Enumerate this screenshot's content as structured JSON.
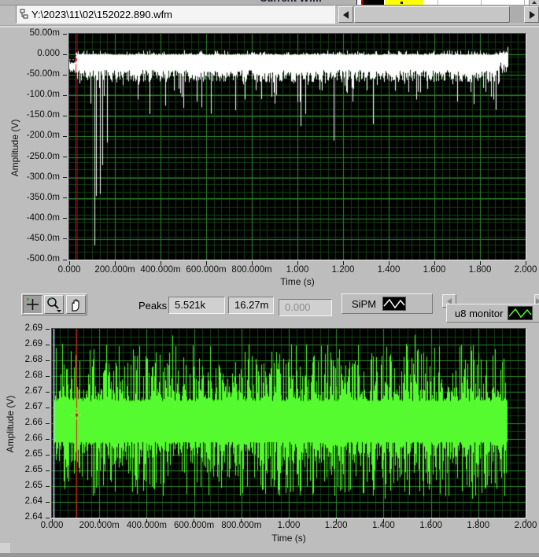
{
  "window": {
    "app": "LabVIEW waveform viewer"
  },
  "top_bar": {
    "clipped_label": "Current Wfm",
    "path_field": {
      "value": "Y:\\2023\\11\\02\\152022.890.wfm",
      "icon": "path-glyph"
    },
    "scrollbar": {
      "orientation": "horizontal"
    }
  },
  "toolbar": {
    "peaks_label": "Peaks",
    "peak_count": "5.521k",
    "peak_value": "16.27m",
    "peak_aux": "0.000",
    "legend_sipm": {
      "label": "SiPM",
      "plot_color": "#ffffff"
    },
    "legend_u8": {
      "label": "u8 monitor",
      "plot_color": "#55fb2e"
    },
    "palette": {
      "tools": [
        "cursor-crosshair",
        "zoom-magnifier",
        "pan-hand"
      ]
    }
  },
  "chart_data": [
    {
      "type": "line",
      "title": "SiPM",
      "xlabel": "Time (s)",
      "ylabel": "Amplitude (V)",
      "x_ticks": [
        "0.000",
        "200.000m",
        "400.000m",
        "600.000m",
        "800.000m",
        "1.000",
        "1.200",
        "1.400",
        "1.600",
        "1.800",
        "2.000"
      ],
      "y_ticks": [
        "50.00m",
        "0.000",
        "-50.00m",
        "-100.0m",
        "-150.0m",
        "-200.0m",
        "-250.0m",
        "-300.0m",
        "-350.0m",
        "-400.0m",
        "-450.0m",
        "-500.0m"
      ],
      "xlim": [
        0,
        2.0
      ],
      "ylim": [
        -0.5,
        0.05
      ],
      "grid": {
        "on": true,
        "minor": "#123f12",
        "major": "#2e8e2e",
        "minor_cols": 60,
        "minor_rows": 30
      },
      "background": "#000000",
      "series_color": "#ffffff",
      "seed": 1337,
      "signal": {
        "t_end": 1.92,
        "baseline_v": 0.0,
        "noise_band": [
          -0.075,
          0.005
        ],
        "lead_t": 0.028,
        "lead_band": [
          -0.048,
          -0.018
        ],
        "spikes": [
          {
            "t": 0.094,
            "v": -0.12
          },
          {
            "t": 0.112,
            "v": -0.465
          },
          {
            "t": 0.117,
            "v": -0.345
          },
          {
            "t": 0.135,
            "v": -0.34
          },
          {
            "t": 0.145,
            "v": -0.27
          },
          {
            "t": 0.166,
            "v": -0.215
          },
          {
            "t": 0.3,
            "v": -0.11
          },
          {
            "t": 0.42,
            "v": -0.125
          },
          {
            "t": 0.5,
            "v": -0.13
          },
          {
            "t": 0.56,
            "v": -0.115
          },
          {
            "t": 0.62,
            "v": -0.145
          },
          {
            "t": 0.77,
            "v": -0.11
          },
          {
            "t": 0.9,
            "v": -0.12
          },
          {
            "t": 1.015,
            "v": -0.175
          },
          {
            "t": 1.035,
            "v": -0.145
          },
          {
            "t": 1.16,
            "v": -0.21
          },
          {
            "t": 1.24,
            "v": -0.115
          },
          {
            "t": 1.33,
            "v": -0.17
          },
          {
            "t": 1.52,
            "v": -0.11
          },
          {
            "t": 1.7,
            "v": -0.115
          },
          {
            "t": 1.87,
            "v": -0.135
          }
        ]
      },
      "cursors": [
        {
          "t": 0.0276,
          "v": -0.012,
          "line_color": "#ee1111",
          "cross_color": "#e8f4ff"
        }
      ]
    },
    {
      "type": "line",
      "title": "u8 monitor",
      "xlabel": "Time (s)",
      "ylabel": "Amplitude (V)",
      "x_ticks": [
        "0.000",
        "200.000m",
        "400.000m",
        "600.000m",
        "800.000m",
        "1.000",
        "1.200",
        "1.400",
        "1.600",
        "1.800",
        "2.000"
      ],
      "y_ticks": [
        "2.69",
        "2.69",
        "2.68",
        "2.68",
        "2.67",
        "2.67",
        "2.66",
        "2.66",
        "2.65",
        "2.65",
        "2.65",
        "2.64",
        "2.64"
      ],
      "xlim": [
        0,
        2.0
      ],
      "ylim": [
        2.6375,
        2.6925
      ],
      "grid": {
        "on": true,
        "minor": "#123f12",
        "major": "#2e8e2e",
        "minor_cols": 60,
        "minor_rows": 24
      },
      "background": "#000000",
      "series_color": "#55fb2e",
      "seed": 424242,
      "signal": {
        "t_end": 1.92,
        "solid_band": [
          2.6595,
          2.6715
        ],
        "peak_max": 2.692,
        "peak_min": 2.643
      },
      "cursors": [
        {
          "t": 0.103,
          "v": 2.6675,
          "line_color": "#ee1111",
          "cross_color": "#e6d44a"
        }
      ],
      "edge_marker": {
        "t": 0.007,
        "color": "#bfe9ff"
      }
    }
  ]
}
